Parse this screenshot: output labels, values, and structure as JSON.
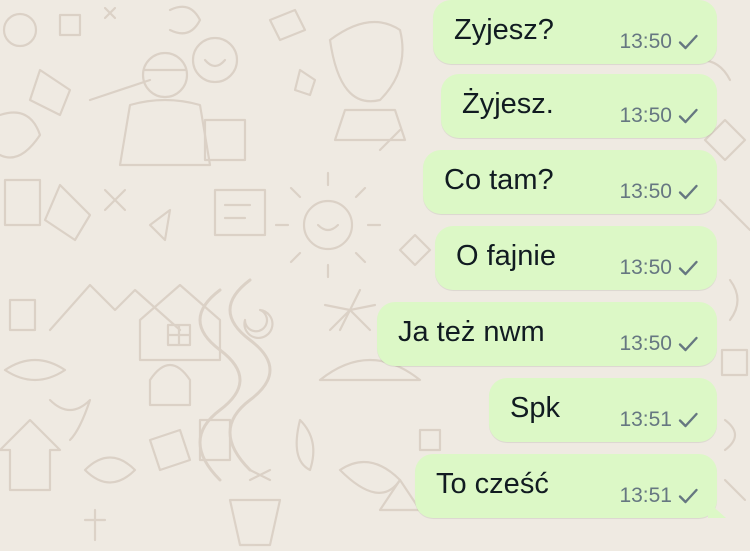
{
  "colors": {
    "background": "#efeae2",
    "outgoing_bubble": "#dcf8c6",
    "message_text": "#111b21",
    "meta_text": "#667781"
  },
  "messages": [
    {
      "text": "Zyjesz?",
      "time": "13:50",
      "status_icon": "single-check-icon"
    },
    {
      "text": "Żyjesz.",
      "time": "13:50",
      "status_icon": "single-check-icon"
    },
    {
      "text": "Co tam?",
      "time": "13:50",
      "status_icon": "single-check-icon"
    },
    {
      "text": "O fajnie",
      "time": "13:50",
      "status_icon": "single-check-icon"
    },
    {
      "text": "Ja też nwm",
      "time": "13:50",
      "status_icon": "single-check-icon"
    },
    {
      "text": "Spk",
      "time": "13:51",
      "status_icon": "single-check-icon"
    },
    {
      "text": "To cześć",
      "time": "13:51",
      "status_icon": "single-check-icon"
    }
  ]
}
